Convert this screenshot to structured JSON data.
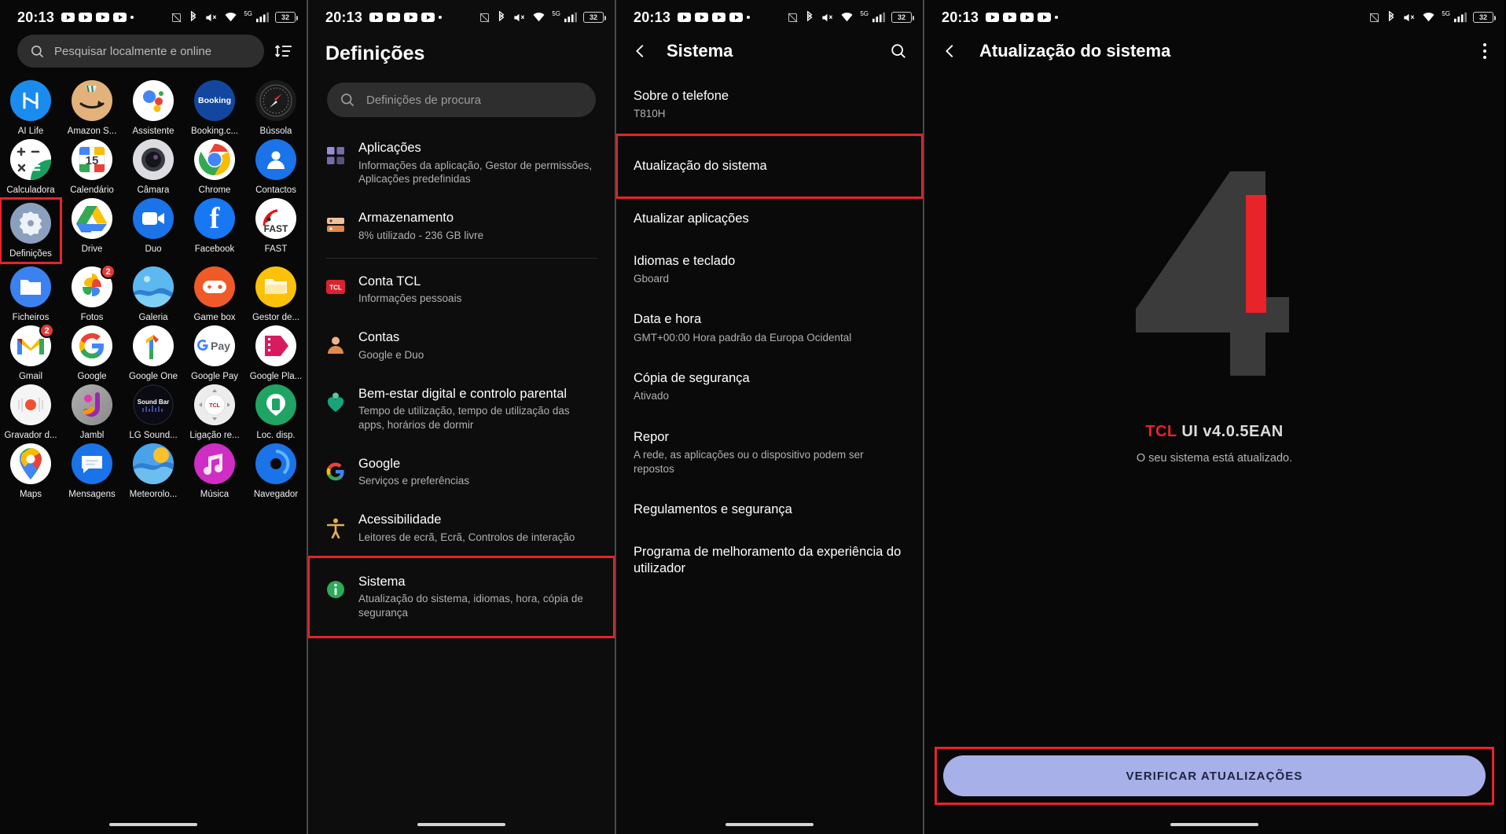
{
  "status_bar": {
    "time": "20:13",
    "media_icon_count": 4,
    "icons": [
      "nfc-off-icon",
      "bluetooth-icon",
      "volume-mute-icon",
      "wifi-icon",
      "signal-icon"
    ],
    "network_label": "5G",
    "battery_level": "32"
  },
  "panel1": {
    "name": "app-drawer",
    "search": {
      "placeholder": "Pesquisar localmente e online",
      "icon": "search-icon"
    },
    "sort_icon": "sort-list-icon",
    "apps": [
      {
        "label": "AI Life",
        "icon": "ai-life-icon",
        "bg": "#1a8cf0",
        "glyph": "⑂"
      },
      {
        "label": "Amazon S...",
        "icon": "amazon-shopping-icon",
        "bg": "#e3b27a",
        "glyph": ""
      },
      {
        "label": "Assistente",
        "icon": "google-assistant-icon",
        "bg": "#ffffff",
        "glyph": ""
      },
      {
        "label": "Booking.c...",
        "icon": "booking-com-icon",
        "bg": "#13479f",
        "glyph": "Booking"
      },
      {
        "label": "Bússola",
        "icon": "compass-icon",
        "bg": "#1b1b1b",
        "glyph": ""
      },
      {
        "label": "Calculadora",
        "icon": "calculator-icon",
        "bg": "#ffffff",
        "glyph": ""
      },
      {
        "label": "Calendário",
        "icon": "google-calendar-icon",
        "bg": "#ffffff",
        "glyph": "15"
      },
      {
        "label": "Câmara",
        "icon": "camera-icon",
        "bg": "#d8d8dc",
        "glyph": ""
      },
      {
        "label": "Chrome",
        "icon": "google-chrome-icon",
        "bg": "#ffffff",
        "glyph": ""
      },
      {
        "label": "Contactos",
        "icon": "contacts-icon",
        "bg": "#1a73e8",
        "glyph": ""
      },
      {
        "label": "Definições",
        "icon": "settings-gear-icon",
        "bg": "#8aa0bd",
        "glyph": "",
        "highlighted": true
      },
      {
        "label": "Drive",
        "icon": "google-drive-icon",
        "bg": "#ffffff",
        "glyph": ""
      },
      {
        "label": "Duo",
        "icon": "google-duo-icon",
        "bg": "#1a73e8",
        "glyph": ""
      },
      {
        "label": "Facebook",
        "icon": "facebook-icon",
        "bg": "#1877f2",
        "glyph": "f"
      },
      {
        "label": "FAST",
        "icon": "fast-speed-test-icon",
        "bg": "#ffffff",
        "glyph": "FAST"
      },
      {
        "label": "Ficheiros",
        "icon": "files-folder-icon",
        "bg": "#3b82f0",
        "glyph": ""
      },
      {
        "label": "Fotos",
        "icon": "google-photos-icon",
        "bg": "#ffffff",
        "glyph": "",
        "badge": "2"
      },
      {
        "label": "Galeria",
        "icon": "gallery-icon",
        "bg": "#3fa9f5",
        "glyph": ""
      },
      {
        "label": "Game box",
        "icon": "game-box-icon",
        "bg": "#ef5a28",
        "glyph": ""
      },
      {
        "label": "Gestor de...",
        "icon": "file-manager-icon",
        "bg": "#fcc10a",
        "glyph": ""
      },
      {
        "label": "Gmail",
        "icon": "gmail-icon",
        "bg": "#ffffff",
        "glyph": "M",
        "badge": "2"
      },
      {
        "label": "Google",
        "icon": "google-icon",
        "bg": "#ffffff",
        "glyph": "G"
      },
      {
        "label": "Google One",
        "icon": "google-one-icon",
        "bg": "#ffffff",
        "glyph": "1"
      },
      {
        "label": "Google Pay",
        "icon": "google-pay-icon",
        "bg": "#ffffff",
        "glyph": "Pay"
      },
      {
        "label": "Google Pla...",
        "icon": "google-play-movies-icon",
        "bg": "#ffffff",
        "glyph": ""
      },
      {
        "label": "Gravador d...",
        "icon": "sound-recorder-icon",
        "bg": "#f5f5f5",
        "glyph": ""
      },
      {
        "label": "Jambl",
        "icon": "jambl-icon",
        "bg": "#9a9a9a",
        "glyph": "J"
      },
      {
        "label": "LG Sound...",
        "icon": "lg-sound-bar-icon",
        "bg": "#0c0c14",
        "glyph": "Sound Bar"
      },
      {
        "label": "Ligação re...",
        "icon": "tcl-remote-icon",
        "bg": "#e9e9e9",
        "glyph": "TCL"
      },
      {
        "label": "Loc. disp.",
        "icon": "find-my-device-icon",
        "bg": "#1fa463",
        "glyph": ""
      },
      {
        "label": "Maps",
        "icon": "google-maps-icon",
        "bg": "#ffffff",
        "glyph": ""
      },
      {
        "label": "Mensagens",
        "icon": "google-messages-icon",
        "bg": "#1a73e8",
        "glyph": ""
      },
      {
        "label": "Meteorolo...",
        "icon": "weather-icon",
        "bg": "#49a3e8",
        "glyph": ""
      },
      {
        "label": "Música",
        "icon": "music-icon",
        "bg": "#cf2ec4",
        "glyph": "♪"
      },
      {
        "label": "Navegador",
        "icon": "browser-icon",
        "bg": "#1a73e8",
        "glyph": ""
      }
    ]
  },
  "panel2": {
    "name": "settings-main",
    "title": "Definições",
    "search": {
      "placeholder": "Definições de procura",
      "icon": "search-icon"
    },
    "items": [
      {
        "title": "Aplicações",
        "subtitle": "Informações da aplicação, Gestor de permissões, Aplicações predefinidas",
        "icon": "apps-grid-icon",
        "color": "#9b8ddb"
      },
      {
        "title": "Armazenamento",
        "subtitle": "8% utilizado - 236 GB livre",
        "icon": "storage-icon",
        "color": "#e08a4f"
      },
      {
        "title": "Conta TCL",
        "subtitle": "Informações pessoais",
        "icon": "tcl-account-icon",
        "color": "#d9232e"
      },
      {
        "title": "Contas",
        "subtitle": "Google e Duo",
        "icon": "accounts-person-icon",
        "color": "#e08a4f"
      },
      {
        "title": "Bem-estar digital e controlo parental",
        "subtitle": "Tempo de utilização, tempo de utilização das apps, horários de dormir",
        "icon": "digital-wellbeing-heart-icon",
        "color": "#18a37a"
      },
      {
        "title": "Google",
        "subtitle": "Serviços e preferências",
        "icon": "google-g-icon",
        "color": "#4285f4"
      },
      {
        "title": "Acessibilidade",
        "subtitle": "Leitores de ecrã, Ecrã, Controlos de interação",
        "icon": "accessibility-icon",
        "color": "#e8b04b"
      },
      {
        "title": "Sistema",
        "subtitle": "Atualização do sistema, idiomas, hora, cópia de segurança",
        "icon": "system-info-icon",
        "color": "#2eaa5a",
        "highlighted": true
      }
    ]
  },
  "panel3": {
    "name": "system-settings",
    "title": "Sistema",
    "back_icon": "back-chevron-icon",
    "search_icon": "search-icon",
    "items": [
      {
        "title": "Sobre o telefone",
        "subtitle": "T810H"
      },
      {
        "title": "Atualização do sistema",
        "subtitle": "",
        "highlighted": true
      },
      {
        "title": "Atualizar aplicações",
        "subtitle": ""
      },
      {
        "title": "Idiomas e teclado",
        "subtitle": "Gboard"
      },
      {
        "title": "Data e hora",
        "subtitle": "GMT+00:00 Hora padrão da Europa Ocidental"
      },
      {
        "title": "Cópia de segurança",
        "subtitle": "Ativado"
      },
      {
        "title": "Repor",
        "subtitle": "A rede, as aplicações ou o dispositivo podem ser repostos"
      },
      {
        "title": "Regulamentos e segurança",
        "subtitle": ""
      },
      {
        "title": "Programa de melhoramento da experiência do utilizador",
        "subtitle": ""
      }
    ]
  },
  "panel4": {
    "name": "system-update",
    "title": "Atualização do sistema",
    "back_icon": "back-chevron-icon",
    "menu_icon": "overflow-menu-icon",
    "hero_numeral": "4",
    "version_brand": "TCL",
    "version_text": "UI  v4.0.5EAN",
    "status_text": "O seu sistema está atualizado.",
    "cta_label": "VERIFICAR ATUALIZAÇÕES",
    "cta_highlighted": true,
    "accent_color": "#e8232a",
    "cta_color": "#a7b0e8"
  }
}
